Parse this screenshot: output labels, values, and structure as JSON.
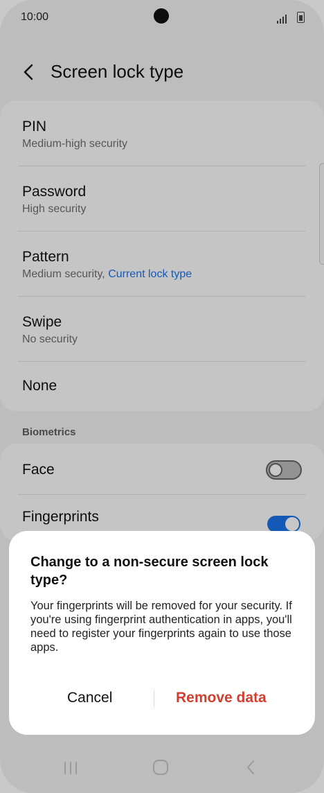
{
  "status_bar": {
    "time": "10:00"
  },
  "header": {
    "title": "Screen lock type"
  },
  "lock_types": [
    {
      "title": "PIN",
      "subtitle": "Medium-high security"
    },
    {
      "title": "Password",
      "subtitle": "High security"
    },
    {
      "title": "Pattern",
      "subtitle": "Medium security,",
      "current_label": "Current lock type"
    },
    {
      "title": "Swipe",
      "subtitle": "No security"
    },
    {
      "title": "None"
    }
  ],
  "biometrics": {
    "section_label": "Biometrics",
    "items": [
      {
        "title": "Face",
        "enabled": false
      },
      {
        "title": "Fingerprints",
        "enabled": true
      }
    ]
  },
  "dialog": {
    "title": "Change to a non-secure screen lock type?",
    "body": "Your fingerprints will be removed for your security. If you're using fingerprint authentication in apps, you'll need to register your fingerprints again to use those apps.",
    "cancel_label": "Cancel",
    "confirm_label": "Remove data"
  },
  "colors": {
    "accent": "#1a73e8",
    "danger": "#d23f31"
  }
}
